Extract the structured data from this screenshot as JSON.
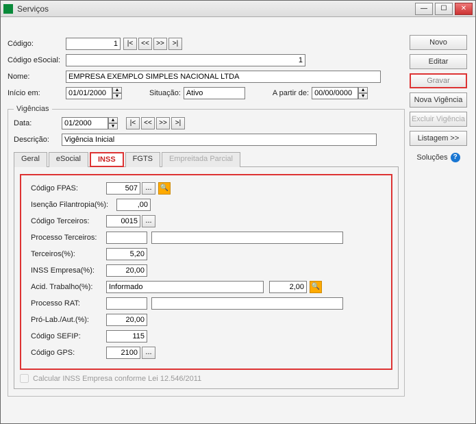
{
  "window": {
    "title": "Serviços"
  },
  "nav": {
    "first": "|<",
    "prev": "<<",
    "next": ">>",
    "last": ">|"
  },
  "header": {
    "codigo_label": "Código:",
    "codigo_value": "1",
    "codigo_esocial_label": "Código eSocial:",
    "codigo_esocial_value": "1",
    "nome_label": "Nome:",
    "nome_value": "EMPRESA EXEMPLO SIMPLES NACIONAL LTDA",
    "inicio_label": "Início em:",
    "inicio_value": "01/01/2000",
    "situacao_label": "Situação:",
    "situacao_value": "Ativo",
    "apartir_label": "A partir de:",
    "apartir_value": "00/00/0000"
  },
  "vigencias": {
    "legend": "Vigências",
    "data_label": "Data:",
    "data_value": "01/2000",
    "descricao_label": "Descrição:",
    "descricao_value": "Vigência Inicial"
  },
  "tabs": {
    "geral": "Geral",
    "esocial": "eSocial",
    "inss": "INSS",
    "fgts": "FGTS",
    "empreitada": "Empreitada Parcial"
  },
  "inss": {
    "codigo_fpas_label": "Código FPAS:",
    "codigo_fpas_value": "507",
    "isencao_label": "Isenção Filantropia(%):",
    "isencao_value": ",00",
    "codigo_terceiros_label": "Código Terceiros:",
    "codigo_terceiros_value": "0015",
    "processo_terceiros_label": "Processo Terceiros:",
    "processo_terceiros_value": "",
    "processo_terceiros_desc": "",
    "terceiros_pct_label": "Terceiros(%):",
    "terceiros_pct_value": "5,20",
    "inss_empresa_label": "INSS Empresa(%):",
    "inss_empresa_value": "20,00",
    "acid_trabalho_label": "Acid. Trabalho(%):",
    "acid_trabalho_sel": "Informado",
    "acid_trabalho_value": "2,00",
    "processo_rat_label": "Processo RAT:",
    "processo_rat_value": "",
    "processo_rat_desc": "",
    "prolab_label": "Pró-Lab./Aut.(%):",
    "prolab_value": "20,00",
    "codigo_sefip_label": "Código SEFIP:",
    "codigo_sefip_value": "115",
    "codigo_gps_label": "Código GPS:",
    "codigo_gps_value": "2100",
    "calc_inss_label": "Calcular INSS Empresa conforme Lei 12.546/2011"
  },
  "buttons": {
    "novo": "Novo",
    "editar": "Editar",
    "gravar": "Gravar",
    "nova_vigencia": "Nova Vigência",
    "excluir_vigencia": "Excluir Vigência",
    "listagem": "Listagem >>",
    "solucoes": "Soluções"
  },
  "icons": {
    "dots": "...",
    "help": "?",
    "search": "🔍"
  }
}
